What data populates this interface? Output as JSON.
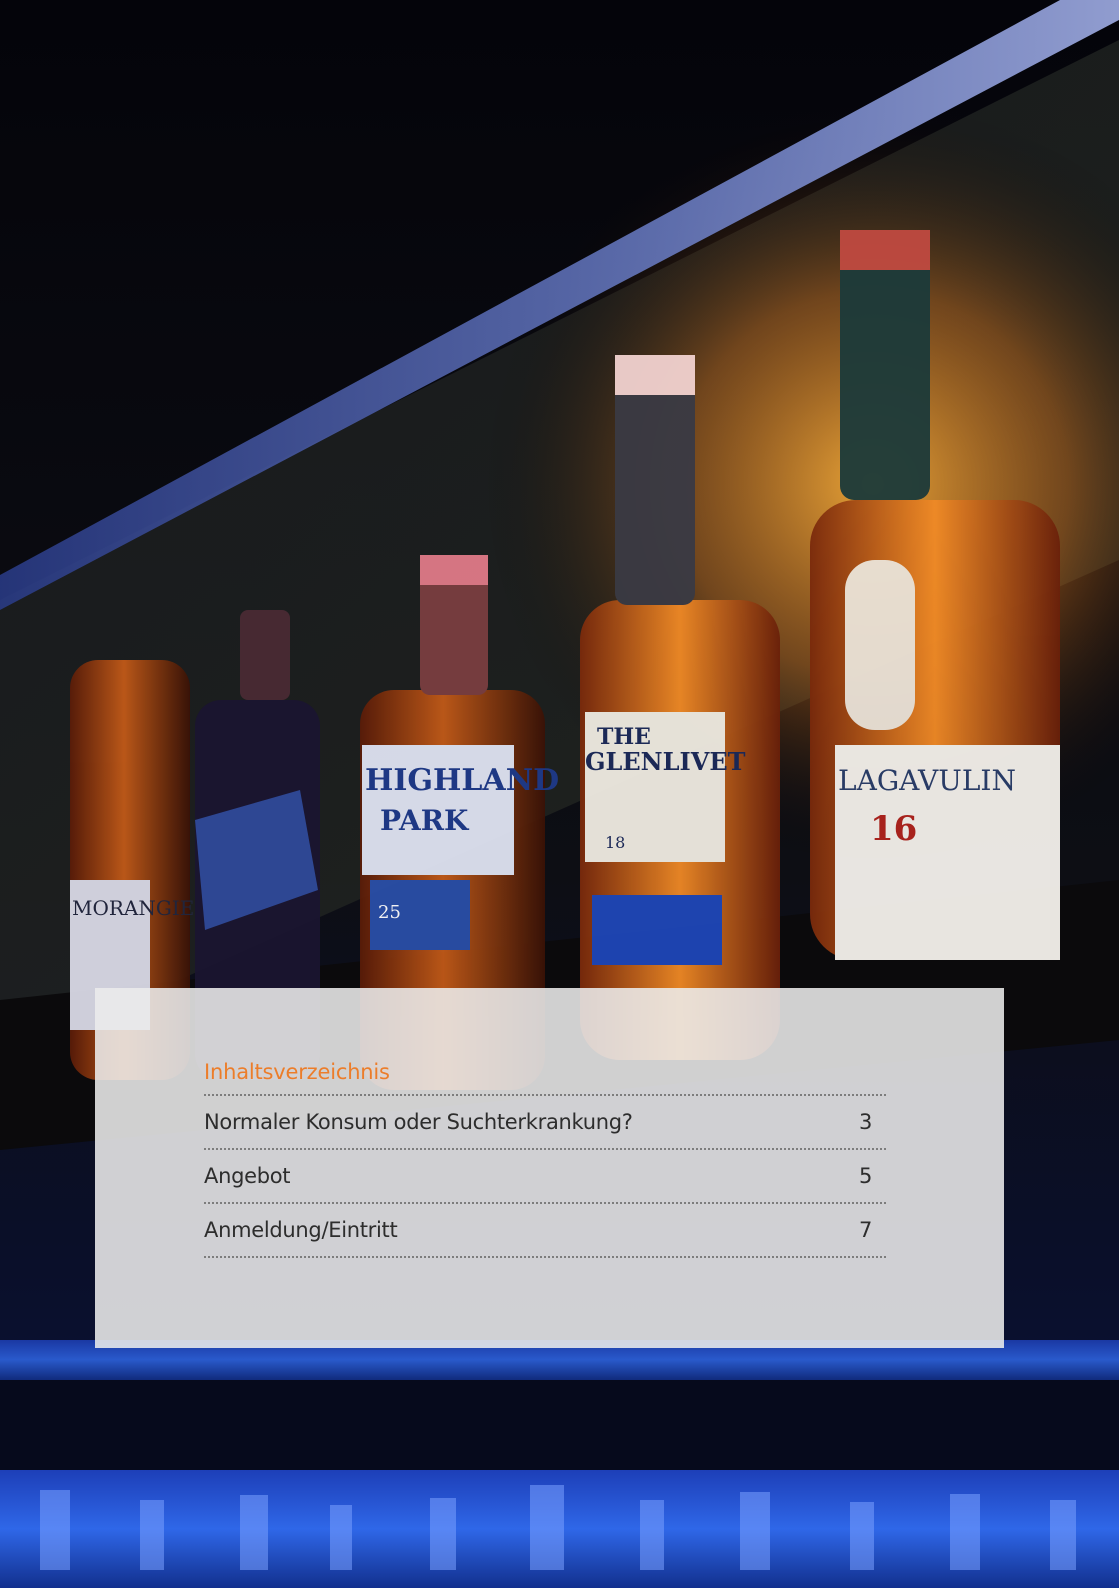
{
  "toc": {
    "title": "Inhaltsverzeichnis",
    "entries": [
      {
        "label": "Normaler Konsum oder Suchterkrankung?",
        "page": "3"
      },
      {
        "label": "Angebot",
        "page": "5"
      },
      {
        "label": "Anmeldung/Eintritt",
        "page": "7"
      }
    ]
  },
  "photo": {
    "bottle_labels": [
      "MORANGIE",
      "HIGHLAND PARK",
      "THE GLENLIVET",
      "LAGAVULIN",
      "16",
      "18",
      "25"
    ]
  },
  "colors": {
    "accent": "#ec7d2a",
    "text": "#2d2d2d",
    "panel": "#ececec"
  }
}
